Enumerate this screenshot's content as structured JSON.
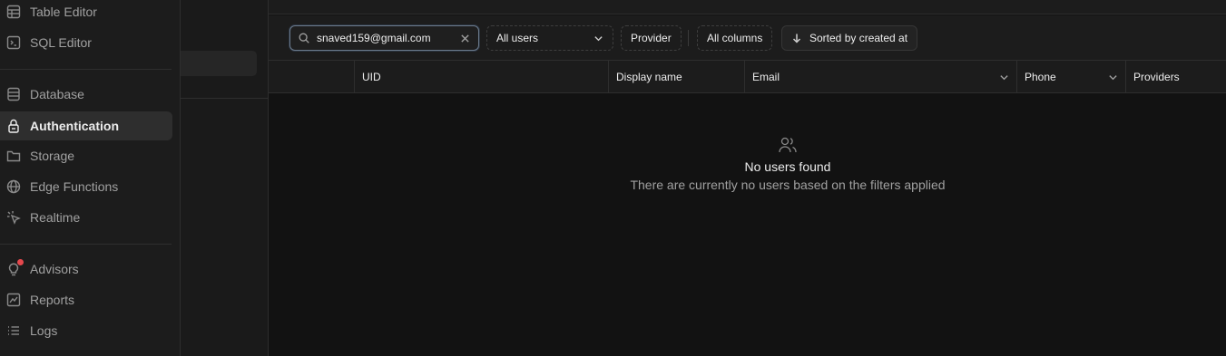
{
  "nav": {
    "items": [
      {
        "label": "Table Editor",
        "icon": "table-icon"
      },
      {
        "label": "SQL Editor",
        "icon": "terminal-icon"
      },
      {
        "label": "Database",
        "icon": "database-icon"
      },
      {
        "label": "Authentication",
        "icon": "lock-icon",
        "active": true
      },
      {
        "label": "Storage",
        "icon": "folder-icon"
      },
      {
        "label": "Edge Functions",
        "icon": "globe-icon"
      },
      {
        "label": "Realtime",
        "icon": "cursor-click-icon"
      },
      {
        "label": "Advisors",
        "icon": "lightbulb-icon",
        "badge": true
      },
      {
        "label": "Reports",
        "icon": "chart-icon"
      },
      {
        "label": "Logs",
        "icon": "list-icon"
      }
    ]
  },
  "toolbar": {
    "search_value": "snaved159@gmail.com",
    "user_filter": "All users",
    "provider_label": "Provider",
    "columns_label": "All columns",
    "sort_label": "Sorted by created at"
  },
  "table": {
    "columns": [
      "UID",
      "Display name",
      "Email",
      "Phone",
      "Providers"
    ]
  },
  "empty_state": {
    "title": "No users found",
    "subtitle": "There are currently no users based on the filters applied"
  },
  "colors": {
    "background": "#121212",
    "surface": "#1c1c1c",
    "border": "#2e2e2e",
    "badge": "#e5484d"
  }
}
